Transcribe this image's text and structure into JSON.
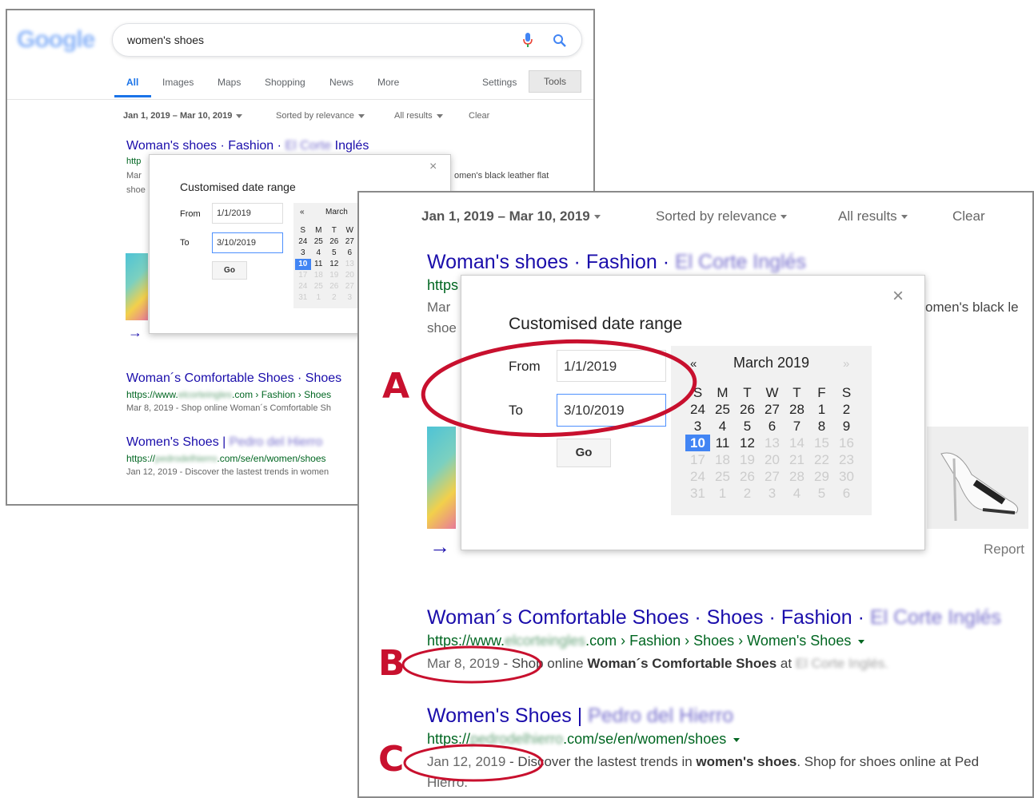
{
  "brand_logo": "Google",
  "search": {
    "query": "women's shoes"
  },
  "tabs": [
    "All",
    "Images",
    "Maps",
    "Shopping",
    "News",
    "More"
  ],
  "settings_label": "Settings",
  "tools_label": "Tools",
  "toolbar": {
    "date": "Jan 1, 2019 – Mar 10, 2019",
    "sort": "Sorted by relevance",
    "results": "All results",
    "clear": "Clear"
  },
  "popup": {
    "title": "Customised date range",
    "from_label": "From",
    "from_value": "1/1/2019",
    "to_label": "To",
    "to_value": "3/10/2019",
    "go_label": "Go",
    "close": "×"
  },
  "calendar": {
    "prev": "«",
    "next": "»",
    "month_full": "March 2019",
    "month_short": "March",
    "days": [
      "S",
      "M",
      "T",
      "W",
      "T",
      "F",
      "S"
    ],
    "weeks": [
      [
        "24",
        "25",
        "26",
        "27",
        "28",
        "1",
        "2"
      ],
      [
        "3",
        "4",
        "5",
        "6",
        "7",
        "8",
        "9"
      ],
      [
        "10",
        "11",
        "12",
        "13",
        "14",
        "15",
        "16"
      ],
      [
        "17",
        "18",
        "19",
        "20",
        "21",
        "22",
        "23"
      ],
      [
        "24",
        "25",
        "26",
        "27",
        "28",
        "29",
        "30"
      ],
      [
        "31",
        "1",
        "2",
        "3",
        "4",
        "5",
        "6"
      ]
    ],
    "selected": "10"
  },
  "results": [
    {
      "title": "Woman's shoes · Fashion · ",
      "title_blur": "El Corte Inglés",
      "title_small_blur": "El Corte",
      "title_small_tail": " Inglés",
      "url_start": "https",
      "url_start_small": "http",
      "snippet_date": "Mar",
      "snippet_line2": "shoe",
      "snippet_line2_small": "shoe",
      "snippet_tail": "omen's black leather flat",
      "snippet_tail_big": "omen's black le",
      "report": "Report"
    },
    {
      "title": "Woman´s Comfortable Shoes · Shoes · Fashion · ",
      "title_small": "Woman´s Comfortable Shoes · Shoes",
      "title_blur": "El Corte Inglés",
      "url_a": "https://www.",
      "url_blur": "elcorteingles",
      "url_b": ".com › Fashion › Shoes › Women's Shoes",
      "url_b_small": ".com › Fashion › Shoes",
      "date": "Mar 8, 2019",
      "snip_a": " - Shop online ",
      "snip_b": "Woman´s Comfortable Shoes",
      "snip_c": " at ",
      "snip_blur": "El Corte Inglés.",
      "snip_small": " - Shop online Woman´s Comfortable Sh"
    },
    {
      "title": "Women's Shoes | ",
      "title_blur": "Pedro del Hierro",
      "url_a": "https://",
      "url_blur": "pedrodelhierro",
      "url_b": ".com/se/en/women/shoes",
      "date": "Jan 12, 2019",
      "snip_a": " - Discover the lastest trends in ",
      "snip_b": "women's shoes",
      "snip_c": ". Shop for shoes online at Ped",
      "snip_d": "Hierro.",
      "snip_small": " - Discover the lastest trends in women"
    }
  ],
  "annotations": [
    "A",
    "B",
    "C"
  ],
  "colors": {
    "link": "#1a0dab",
    "url": "#006621",
    "annotation": "#c8102e",
    "selected_day": "#4285f4",
    "active_tab": "#1a73e8"
  }
}
